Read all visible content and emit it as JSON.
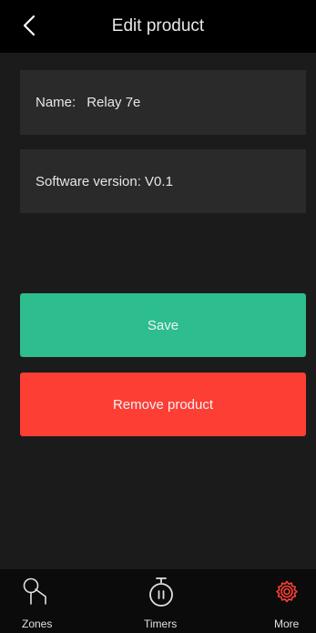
{
  "header": {
    "title": "Edit product"
  },
  "fields": {
    "name_label": "Name:",
    "name_value": "Relay 7e",
    "version_text": "Software version: V0.1"
  },
  "actions": {
    "save_label": "Save",
    "remove_label": "Remove product"
  },
  "tabs": [
    {
      "label": "Zones",
      "icon": "zones-icon",
      "active": false
    },
    {
      "label": "Timers",
      "icon": "stopwatch-icon",
      "active": false
    },
    {
      "label": "More",
      "icon": "gear-icon",
      "active": true
    }
  ],
  "colors": {
    "save": "#2dbd8f",
    "remove": "#fd3e35",
    "active_tab_icon": "#fd3e35",
    "background": "#1b1b1b",
    "header": "#000000"
  }
}
